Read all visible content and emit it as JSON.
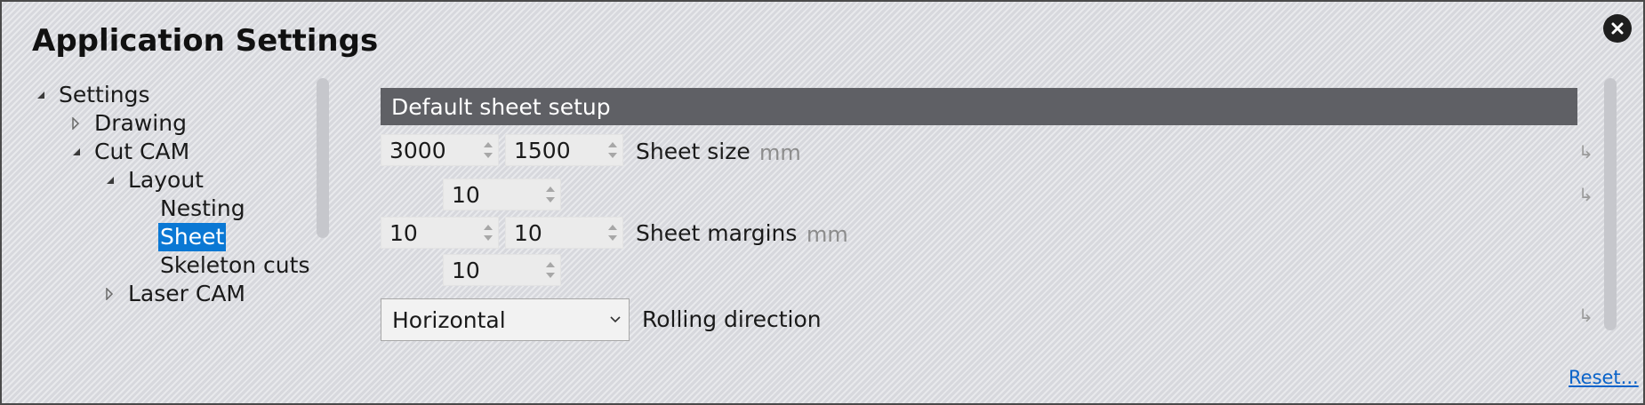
{
  "dialog": {
    "title": "Application Settings",
    "close_icon": "close-icon"
  },
  "tree": {
    "items": [
      {
        "label": "Settings",
        "state": "expanded"
      },
      {
        "label": "Drawing",
        "state": "collapsed"
      },
      {
        "label": "Cut CAM",
        "state": "expanded"
      },
      {
        "label": "Layout",
        "state": "expanded"
      },
      {
        "label": "Nesting",
        "state": "leaf"
      },
      {
        "label": "Sheet",
        "state": "leaf",
        "selected": true
      },
      {
        "label": "Skeleton cuts",
        "state": "leaf"
      },
      {
        "label": "Laser CAM",
        "state": "collapsed"
      }
    ]
  },
  "content": {
    "section_title": "Default sheet setup",
    "sheet_size": {
      "width": "3000",
      "height": "1500",
      "label": "Sheet size",
      "unit": "mm"
    },
    "sheet_margins": {
      "top": "10",
      "left": "10",
      "right": "10",
      "bottom": "10",
      "label": "Sheet margins",
      "unit": "mm"
    },
    "rolling_direction": {
      "value": "Horizontal",
      "label": "Rolling direction"
    },
    "reset_label": "Reset..."
  },
  "colors": {
    "selection": "#0a78d4",
    "section_header": "#5f6065",
    "link": "#0a63c9"
  }
}
